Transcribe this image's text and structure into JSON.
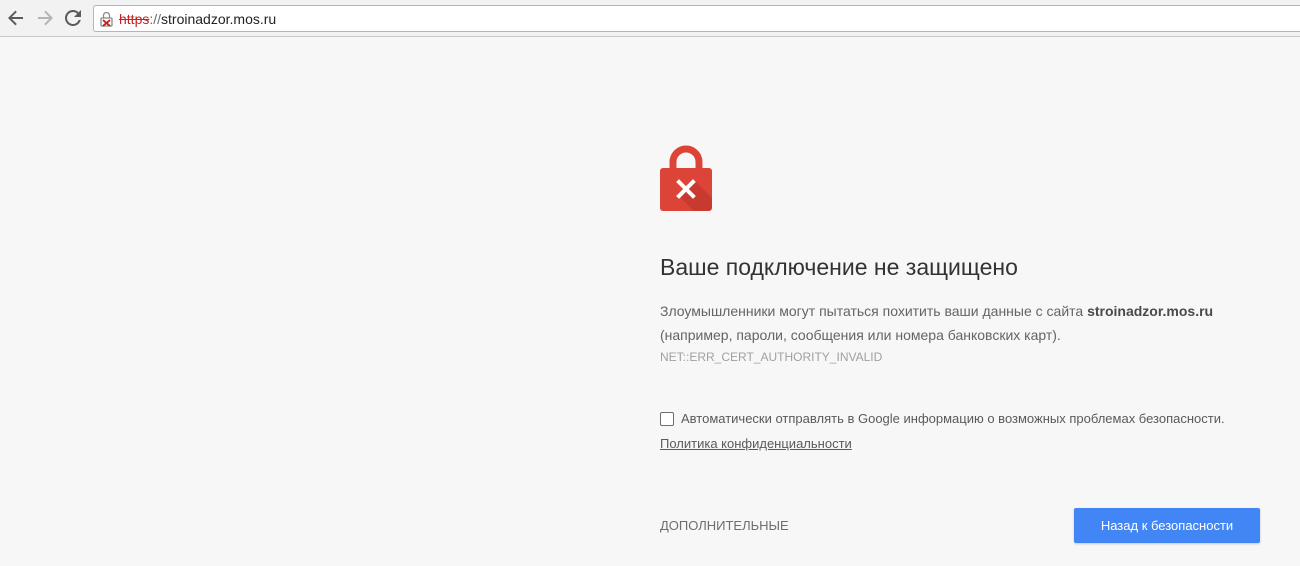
{
  "browser": {
    "url_scheme": "https",
    "url_separator": "://",
    "url_host": "stroinadzor.mos.ru",
    "back_icon": "arrow-left",
    "forward_icon": "arrow-right",
    "reload_icon": "reload",
    "security_icon": "broken-lock"
  },
  "interstitial": {
    "icon": "lock-error",
    "icon_color": "#db4437",
    "headline": "Ваше подключение не защищено",
    "desc_part1": "Злоумышленники могут пытаться похитить ваши данные с сайта ",
    "desc_host": "stroinadzor.mos.ru",
    "desc_part2": " (например, пароли, сообщения или номера банковских карт).",
    "error_code": "NET::ERR_CERT_AUTHORITY_INVALID",
    "checkbox_label": "Автоматически отправлять в Google информацию о возможных проблемах безопасности.",
    "checkbox_checked": false,
    "privacy_link": "Политика конфиденциальности",
    "advanced_label": "ДОПОЛНИТЕЛЬНЫЕ",
    "back_button_label": "Назад к безопасности",
    "accent_color": "#4285f4"
  }
}
